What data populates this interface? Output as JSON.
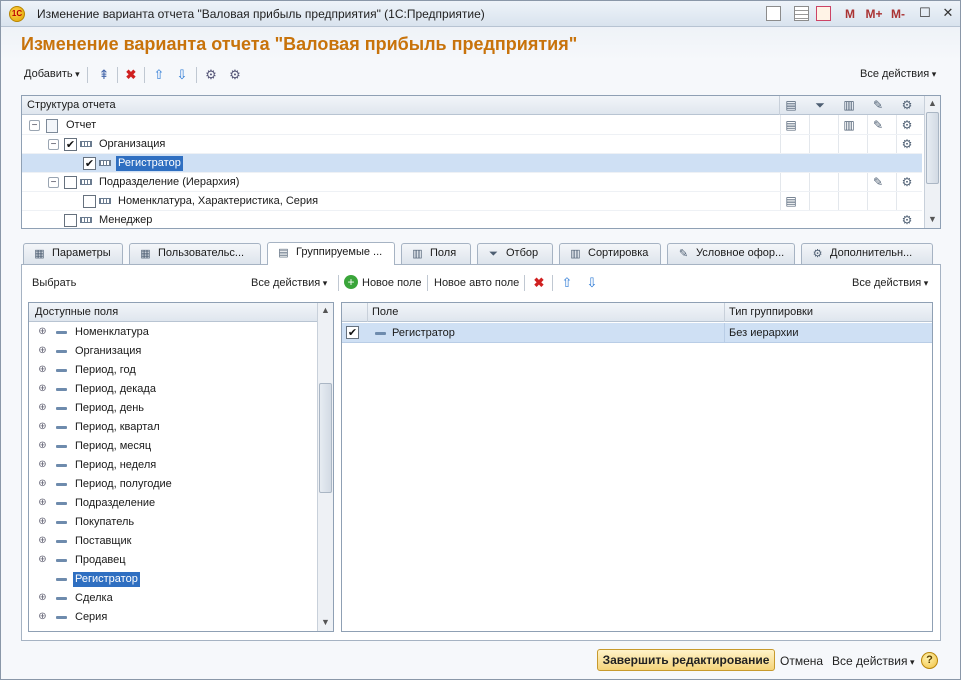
{
  "window": {
    "title": "Изменение варианта отчета \"Валовая прибыль предприятия\"  (1С:Предприятие)",
    "logo_text": "1С",
    "toolbar_buttons": [
      "M",
      "M+",
      "M-"
    ]
  },
  "form": {
    "title": "Изменение варианта отчета \"Валовая прибыль предприятия\"",
    "add_label": "Добавить",
    "all_actions_label": "Все действия"
  },
  "structure": {
    "header": "Структура отчета",
    "rows": [
      {
        "label": "Отчет"
      },
      {
        "label": "Организация"
      },
      {
        "label": "Регистратор"
      },
      {
        "label": "Подразделение (Иерархия)"
      },
      {
        "label": "Номенклатура, Характеристика, Серия"
      },
      {
        "label": "Менеджер"
      }
    ]
  },
  "tabs": [
    {
      "label": "Параметры",
      "icon": "table-icon"
    },
    {
      "label": "Пользовательс...",
      "icon": "table-icon"
    },
    {
      "label": "Группируемые ...",
      "icon": "grouping-icon"
    },
    {
      "label": "Поля",
      "icon": "fields-icon"
    },
    {
      "label": "Отбор",
      "icon": "filter-icon"
    },
    {
      "label": "Сортировка",
      "icon": "sort-icon"
    },
    {
      "label": "Условное офор...",
      "icon": "brush-icon"
    },
    {
      "label": "Дополнительн...",
      "icon": "gear-icon"
    }
  ],
  "grouping": {
    "select_label": "Выбрать",
    "left_all_actions": "Все действия",
    "new_field_label": "Новое поле",
    "new_auto_field_label": "Новое авто поле",
    "right_all_actions": "Все действия",
    "available_header": "Доступные поля",
    "available_fields": [
      "Номенклатура",
      "Организация",
      "Период, год",
      "Период, декада",
      "Период, день",
      "Период, квартал",
      "Период, месяц",
      "Период, неделя",
      "Период, полугодие",
      "Подразделение",
      "Покупатель",
      "Поставщик",
      "Продавец",
      "Регистратор",
      "Сделка",
      "Серия"
    ],
    "grid_headers": {
      "field": "Поле",
      "group_type": "Тип группировки"
    },
    "grid_rows": [
      {
        "field": "Регистратор",
        "group_type": "Без иерархии"
      }
    ]
  },
  "footer": {
    "finish_label": "Завершить редактирование",
    "cancel_label": "Отмена",
    "all_actions_label": "Все действия",
    "help_label": "?"
  }
}
